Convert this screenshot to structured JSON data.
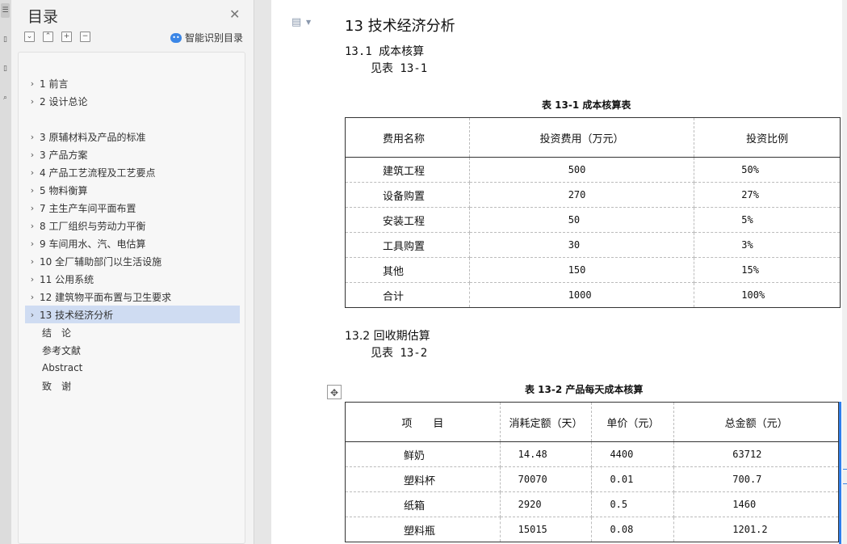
{
  "toc": {
    "title": "目录",
    "smart_label": "智能识别目录",
    "items": [
      {
        "label": "1  前言",
        "has_children": true
      },
      {
        "label": "2  设计总论",
        "has_children": true
      },
      {
        "label": "3  原辅材料及产品的标准",
        "has_children": true
      },
      {
        "label": "3  产品方案",
        "has_children": true
      },
      {
        "label": "4  产品工艺流程及工艺要点",
        "has_children": true
      },
      {
        "label": "5  物料衡算",
        "has_children": true
      },
      {
        "label": "7  主生产车间平面布置",
        "has_children": true
      },
      {
        "label": "8  工厂组织与劳动力平衡",
        "has_children": true
      },
      {
        "label": "9  车间用水、汽、电估算",
        "has_children": true
      },
      {
        "label": "10  全厂辅助部门以生活设施",
        "has_children": true
      },
      {
        "label": "11  公用系统",
        "has_children": true
      },
      {
        "label": "12  建筑物平面布置与卫生要求",
        "has_children": true
      },
      {
        "label": "13  技术经济分析",
        "has_children": true,
        "selected": true
      },
      {
        "label": "结　论",
        "has_children": false
      },
      {
        "label": "参考文献",
        "has_children": false
      },
      {
        "label": "Abstract",
        "has_children": false
      },
      {
        "label": "致　谢",
        "has_children": false
      }
    ]
  },
  "doc": {
    "heading": "13  技术经济分析",
    "sec1": "13.1  成本核算",
    "sec1_text": "见表 13-1",
    "table1": {
      "caption": "表 13-1  成本核算表",
      "headers": [
        "费用名称",
        "投资费用（万元）",
        "投资比例"
      ],
      "rows": [
        [
          "建筑工程",
          "500",
          "50%"
        ],
        [
          "设备购置",
          "270",
          "27%"
        ],
        [
          "安装工程",
          "50",
          "5%"
        ],
        [
          "工具购置",
          "30",
          "3%"
        ],
        [
          "其他",
          "150",
          "15%"
        ],
        [
          "合计",
          "1000",
          "100%"
        ]
      ]
    },
    "sec2": "13.2 回收期估算",
    "sec2_text": "见表 13-2",
    "table2": {
      "caption": "表 13-2  产品每天成本核算",
      "headers": [
        "项　　目",
        "消耗定额（天）",
        "单价（元）",
        "总金额（元）"
      ],
      "rows": [
        [
          "鲜奶",
          "14.48",
          "4400",
          "63712"
        ],
        [
          "塑料杯",
          "70070",
          "0.01",
          "700.7"
        ],
        [
          "纸箱",
          "2920",
          "0.5",
          "1460"
        ],
        [
          "塑料瓶",
          "15015",
          "0.08",
          "1201.2"
        ]
      ]
    }
  }
}
